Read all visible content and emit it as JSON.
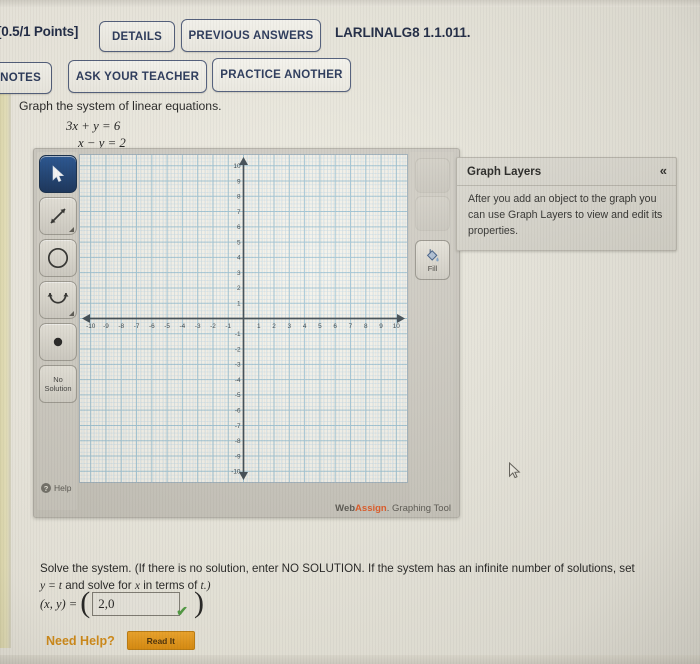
{
  "header": {
    "points": "[0.5/1 Points]",
    "question_code": "LARLINALG8 1.1.011.",
    "buttons": {
      "details": "DETAILS",
      "previous_answers": "PREVIOUS ANSWERS",
      "my_notes": "Y NOTES",
      "ask_your_teacher": "ASK YOUR TEACHER",
      "practice_another": "PRACTICE ANOTHER"
    }
  },
  "question": {
    "prompt": "Graph the system of linear equations.",
    "equation_1": "3x + y = 6",
    "equation_2": "x − y = 2"
  },
  "graphing_tool": {
    "brand_web": "Web",
    "brand_assign": "Assign",
    "brand_tail": ". Graphing Tool",
    "tools": [
      {
        "name": "pointer",
        "label": ""
      },
      {
        "name": "line",
        "label": ""
      },
      {
        "name": "circle",
        "label": ""
      },
      {
        "name": "parabola",
        "label": ""
      },
      {
        "name": "point",
        "label": ""
      }
    ],
    "no_solution_label": "No Solution",
    "help_label": "Help",
    "fill_label": "Fill",
    "layers": {
      "title": "Graph Layers",
      "collapse_icon": "«",
      "body": "After you add an object to the graph you can use Graph Layers to view and edit its properties."
    }
  },
  "chart_data": {
    "type": "scatter",
    "title": "",
    "xlabel": "",
    "ylabel": "",
    "xlim": [
      -10.7,
      10.7
    ],
    "ylim": [
      -10.7,
      10.7
    ],
    "xticks": [
      -10,
      -9,
      -8,
      -7,
      -6,
      -5,
      -4,
      -3,
      -2,
      -1,
      1,
      2,
      3,
      4,
      5,
      6,
      7,
      8,
      9,
      10
    ],
    "yticks": [
      10,
      9,
      8,
      7,
      6,
      5,
      4,
      3,
      2,
      1,
      -1,
      -2,
      -3,
      -4,
      -5,
      -6,
      -7,
      -8,
      -9,
      -10
    ],
    "grid": true,
    "minor_grid_divisions": 4,
    "grid_color": "#9ec3d4",
    "minor_grid_color": "#cfe0e8",
    "axis_color": "#39454d",
    "background": "#f4f2ea",
    "series": [],
    "legend": "none",
    "axes_arrows": true
  },
  "answer": {
    "solve_text_line1": "Solve the system. (If there is no solution, enter NO SOLUTION. If the system has an infinite number of solutions, set",
    "solve_text_line2_a": "y = t",
    "solve_text_line2_b": " and solve for ",
    "solve_text_line2_c": "x",
    "solve_text_line2_d": " in terms of ",
    "solve_text_line2_e": "t.)",
    "xy_label": "(x, y) =",
    "open_paren": "(",
    "close_paren": ")",
    "input_value": "2,0",
    "input_placeholder": "",
    "correct_mark": "✔",
    "need_help_label": "Need Help?",
    "read_it_label": "Read It"
  }
}
